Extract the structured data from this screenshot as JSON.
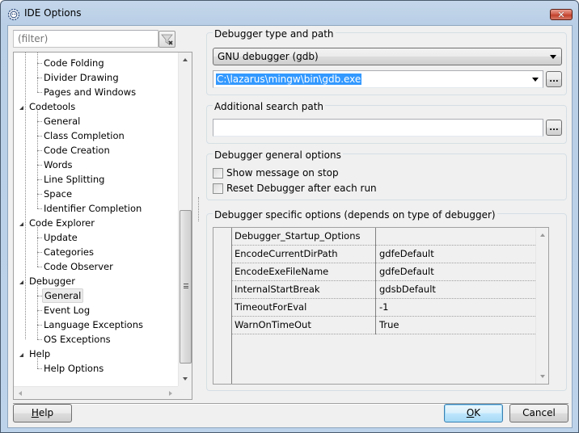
{
  "window": {
    "title": "IDE Options",
    "icon": "lazarus-gear-icon",
    "close_label": "✕"
  },
  "filter": {
    "placeholder": "(filter)",
    "clear_icon": "filter-clear-icon"
  },
  "tree": {
    "items": [
      {
        "label": "Code Folding",
        "level": 1,
        "expanded": null,
        "selected": false
      },
      {
        "label": "Divider Drawing",
        "level": 1,
        "expanded": null,
        "selected": false
      },
      {
        "label": "Pages and Windows",
        "level": 1,
        "expanded": null,
        "selected": false
      },
      {
        "label": "Codetools",
        "level": 0,
        "expanded": true,
        "selected": false
      },
      {
        "label": "General",
        "level": 1,
        "expanded": null,
        "selected": false
      },
      {
        "label": "Class Completion",
        "level": 1,
        "expanded": null,
        "selected": false
      },
      {
        "label": "Code Creation",
        "level": 1,
        "expanded": null,
        "selected": false
      },
      {
        "label": "Words",
        "level": 1,
        "expanded": null,
        "selected": false
      },
      {
        "label": "Line Splitting",
        "level": 1,
        "expanded": null,
        "selected": false
      },
      {
        "label": "Space",
        "level": 1,
        "expanded": null,
        "selected": false
      },
      {
        "label": "Identifier Completion",
        "level": 1,
        "expanded": null,
        "selected": false
      },
      {
        "label": "Code Explorer",
        "level": 0,
        "expanded": true,
        "selected": false
      },
      {
        "label": "Update",
        "level": 1,
        "expanded": null,
        "selected": false
      },
      {
        "label": "Categories",
        "level": 1,
        "expanded": null,
        "selected": false
      },
      {
        "label": "Code Observer",
        "level": 1,
        "expanded": null,
        "selected": false
      },
      {
        "label": "Debugger",
        "level": 0,
        "expanded": true,
        "selected": false
      },
      {
        "label": "General",
        "level": 1,
        "expanded": null,
        "selected": true
      },
      {
        "label": "Event Log",
        "level": 1,
        "expanded": null,
        "selected": false
      },
      {
        "label": "Language Exceptions",
        "level": 1,
        "expanded": null,
        "selected": false
      },
      {
        "label": "OS Exceptions",
        "level": 1,
        "expanded": null,
        "selected": false
      },
      {
        "label": "Help",
        "level": 0,
        "expanded": true,
        "selected": false
      },
      {
        "label": "Help Options",
        "level": 1,
        "expanded": null,
        "selected": false
      }
    ]
  },
  "debugger_type": {
    "group_title": "Debugger type and path",
    "type_selected": "GNU debugger (gdb)",
    "path_value": "C:\\lazarus\\mingw\\bin\\gdb.exe",
    "browse_label": "..."
  },
  "search_path": {
    "group_title": "Additional search path",
    "value": "",
    "browse_label": "..."
  },
  "general_options": {
    "group_title": "Debugger general options",
    "checkboxes": [
      {
        "label": "Show message on stop",
        "checked": false
      },
      {
        "label": "Reset Debugger after each run",
        "checked": false
      }
    ]
  },
  "specific_options": {
    "group_title": "Debugger specific options (depends on type of debugger)",
    "rows": [
      {
        "name": "Debugger_Startup_Options",
        "value": ""
      },
      {
        "name": "EncodeCurrentDirPath",
        "value": "gdfeDefault"
      },
      {
        "name": "EncodeExeFileName",
        "value": "gdfeDefault"
      },
      {
        "name": "InternalStartBreak",
        "value": "gdsbDefault"
      },
      {
        "name": "TimeoutForEval",
        "value": "-1"
      },
      {
        "name": "WarnOnTimeOut",
        "value": "True"
      }
    ]
  },
  "buttons": {
    "help": {
      "prefix": "",
      "mnemonic": "H",
      "rest": "elp"
    },
    "ok": {
      "prefix": "",
      "mnemonic": "O",
      "rest": "K"
    },
    "cancel": "Cancel"
  },
  "colors": {
    "selection": "#3399ff",
    "default_button_border": "#3c7fb1",
    "close_button": "#c0402a"
  }
}
